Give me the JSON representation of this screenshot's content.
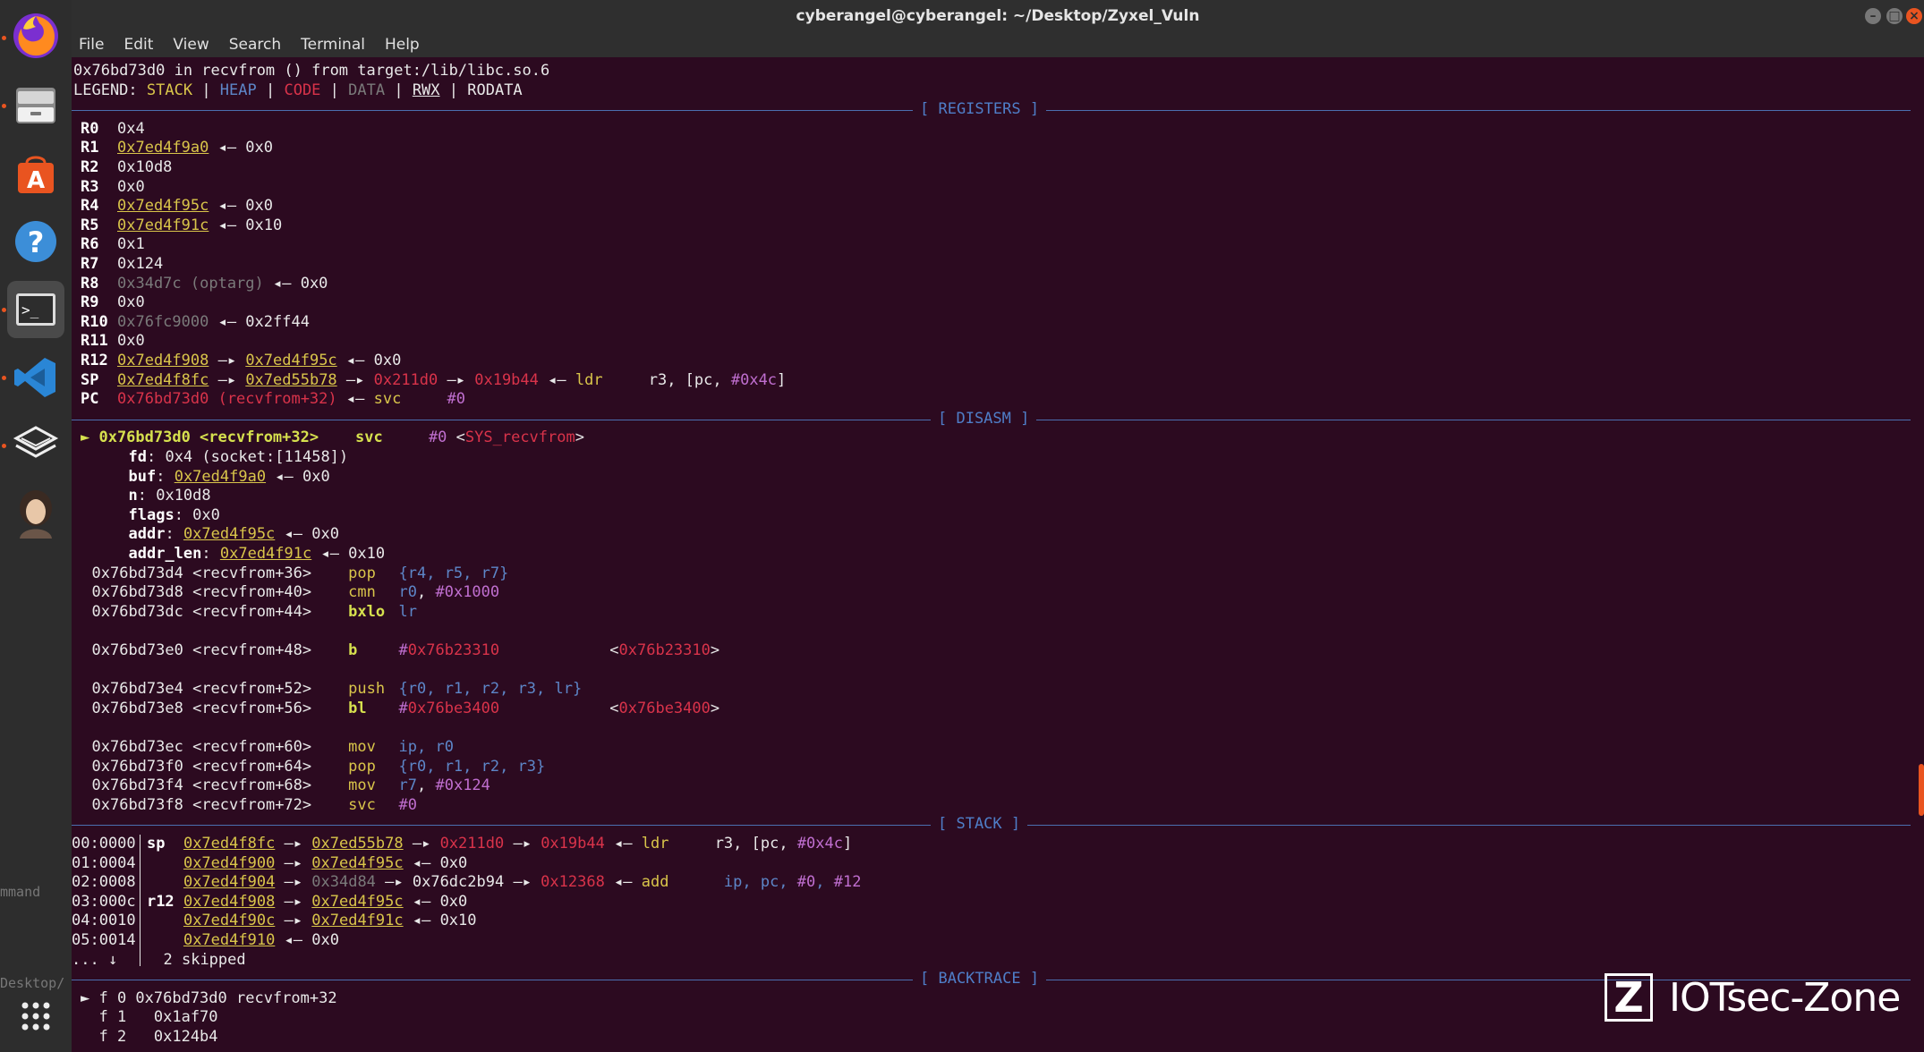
{
  "window": {
    "title": "cyberangel@cyberangel: ~/Desktop/Zyxel_Vuln",
    "menu": [
      "File",
      "Edit",
      "View",
      "Search",
      "Terminal",
      "Help"
    ]
  },
  "dock": {
    "items": [
      "firefox-icon",
      "files-icon",
      "app-store-icon",
      "help-icon",
      "terminal-icon",
      "vscode-icon",
      "layers-app-icon",
      "avatar-app-icon"
    ],
    "ghost_texts": [
      "mmand",
      "Desktop/"
    ]
  },
  "colors": {
    "background": "#2c0a20",
    "header": "#4f7ec8",
    "pointer": "#d9c54a",
    "code": "#d9334a",
    "accent": "#e95420"
  },
  "terminal": {
    "top_line": "0x76bd73d0 in recvfrom () from target:/lib/libc.so.6",
    "legend": {
      "label": "LEGEND: ",
      "stack": "STACK",
      "heap": "HEAP",
      "code": "CODE",
      "data": "DATA",
      "rwx": "RWX",
      "rodata": "RODATA",
      "sep": " | "
    },
    "sections": {
      "registers": "[ REGISTERS ]",
      "disasm": "[ DISASM ]",
      "stack": "[ STACK ]",
      "backtrace": "[ BACKTRACE ]"
    },
    "registers": [
      {
        "name": "R0",
        "parts": [
          [
            "w",
            "0x4"
          ]
        ]
      },
      {
        "name": "R1",
        "parts": [
          [
            "u",
            "0x7ed4f9a0"
          ],
          [
            "w",
            " ◂— 0x0"
          ]
        ]
      },
      {
        "name": "R2",
        "parts": [
          [
            "w",
            "0x10d8"
          ]
        ]
      },
      {
        "name": "R3",
        "parts": [
          [
            "w",
            "0x0"
          ]
        ]
      },
      {
        "name": "R4",
        "parts": [
          [
            "u",
            "0x7ed4f95c"
          ],
          [
            "w",
            " ◂— 0x0"
          ]
        ]
      },
      {
        "name": "R5",
        "parts": [
          [
            "u",
            "0x7ed4f91c"
          ],
          [
            "w",
            " ◂— 0x10"
          ]
        ]
      },
      {
        "name": "R6",
        "parts": [
          [
            "w",
            "0x1"
          ]
        ]
      },
      {
        "name": "R7",
        "parts": [
          [
            "w",
            "0x124"
          ]
        ]
      },
      {
        "name": "R8",
        "parts": [
          [
            "g",
            "0x34d7c (optarg)"
          ],
          [
            "w",
            " ◂— 0x0"
          ]
        ]
      },
      {
        "name": "R9",
        "parts": [
          [
            "w",
            "0x0"
          ]
        ]
      },
      {
        "name": "R10",
        "parts": [
          [
            "g",
            "0x76fc9000"
          ],
          [
            "w",
            " ◂— 0x2ff44"
          ]
        ]
      },
      {
        "name": "R11",
        "parts": [
          [
            "w",
            "0x0"
          ]
        ]
      },
      {
        "name": "R12",
        "parts": [
          [
            "u",
            "0x7ed4f908"
          ],
          [
            "w",
            " —▸ "
          ],
          [
            "u",
            "0x7ed4f95c"
          ],
          [
            "w",
            " ◂— 0x0"
          ]
        ]
      },
      {
        "name": "SP",
        "parts": [
          [
            "u",
            "0x7ed4f8fc"
          ],
          [
            "w",
            " —▸ "
          ],
          [
            "u",
            "0x7ed55b78"
          ],
          [
            "w",
            " —▸ "
          ],
          [
            "r",
            "0x211d0"
          ],
          [
            "w",
            " —▸ "
          ],
          [
            "r",
            "0x19b44"
          ],
          [
            "w",
            " ◂— "
          ],
          [
            "y",
            "ldr    "
          ],
          [
            "w",
            " r3, [pc, "
          ],
          [
            "m",
            "#0x4c"
          ],
          [
            "w",
            "]"
          ]
        ]
      },
      {
        "name": "PC",
        "parts": [
          [
            "r",
            "0x76bd73d0 (recvfrom+32)"
          ],
          [
            "w",
            " ◂— "
          ],
          [
            "y",
            "svc    "
          ],
          [
            "w",
            " "
          ],
          [
            "m",
            "#0"
          ]
        ]
      }
    ],
    "disasm": {
      "current": [
        [
          "gr",
          "► 0x76bd73d0 <recvfrom+32>    svc    "
        ],
        [
          "m",
          " #0"
        ],
        [
          "w",
          " <"
        ],
        [
          "r",
          "SYS_recvfrom"
        ],
        [
          "w",
          ">"
        ]
      ],
      "args": [
        [
          [
            "b",
            "fd"
          ],
          [
            "w",
            ": 0x4 (socket:[11458])"
          ]
        ],
        [
          [
            "b",
            "buf"
          ],
          [
            "w",
            ": "
          ],
          [
            "u",
            "0x7ed4f9a0"
          ],
          [
            "w",
            " ◂— 0x0"
          ]
        ],
        [
          [
            "b",
            "n"
          ],
          [
            "w",
            ": 0x10d8"
          ]
        ],
        [
          [
            "b",
            "flags"
          ],
          [
            "w",
            ": 0x0"
          ]
        ],
        [
          [
            "b",
            "addr"
          ],
          [
            "w",
            ": "
          ],
          [
            "u",
            "0x7ed4f95c"
          ],
          [
            "w",
            " ◂— 0x0"
          ]
        ],
        [
          [
            "b",
            "addr_len"
          ],
          [
            "w",
            ": "
          ],
          [
            "u",
            "0x7ed4f91c"
          ],
          [
            "w",
            " ◂— 0x10"
          ]
        ]
      ],
      "lines": [
        {
          "gap": 0,
          "addr": "0x76bd73d4 <recvfrom+36>",
          "mn": "pop",
          "mc": "y",
          "ops": [
            [
              "bl",
              "{r4, r5, r7}"
            ]
          ]
        },
        {
          "gap": 0,
          "addr": "0x76bd73d8 <recvfrom+40>",
          "mn": "cmn",
          "mc": "y",
          "ops": [
            [
              "bl",
              "r0"
            ],
            [
              "w",
              ", "
            ],
            [
              "m",
              "#0x1000"
            ]
          ]
        },
        {
          "gap": 0,
          "addr": "0x76bd73dc <recvfrom+44>",
          "mn": "bxlo",
          "mc": "gr",
          "ops": [
            [
              "bl",
              "lr"
            ]
          ]
        },
        {
          "gap": 1,
          "addr": "0x76bd73e0 <recvfrom+48>",
          "mn": "b",
          "mc": "gr",
          "ops": [
            [
              "m",
              "#"
            ],
            [
              "r",
              "0x76b23310"
            ]
          ],
          "target": "0x76b23310"
        },
        {
          "gap": 1,
          "addr": "0x76bd73e4 <recvfrom+52>",
          "mn": "push",
          "mc": "y",
          "ops": [
            [
              "bl",
              "{r0, r1, r2, r3, lr}"
            ]
          ]
        },
        {
          "gap": 0,
          "addr": "0x76bd73e8 <recvfrom+56>",
          "mn": "bl",
          "mc": "gr",
          "ops": [
            [
              "m",
              "#"
            ],
            [
              "r",
              "0x76be3400"
            ]
          ],
          "target": "0x76be3400"
        },
        {
          "gap": 1,
          "addr": "0x76bd73ec <recvfrom+60>",
          "mn": "mov",
          "mc": "y",
          "ops": [
            [
              "bl",
              "ip, r0"
            ]
          ]
        },
        {
          "gap": 0,
          "addr": "0x76bd73f0 <recvfrom+64>",
          "mn": "pop",
          "mc": "y",
          "ops": [
            [
              "bl",
              "{r0, r1, r2, r3}"
            ]
          ]
        },
        {
          "gap": 0,
          "addr": "0x76bd73f4 <recvfrom+68>",
          "mn": "mov",
          "mc": "y",
          "ops": [
            [
              "bl",
              "r7"
            ],
            [
              "w",
              ", "
            ],
            [
              "m",
              "#0x124"
            ]
          ]
        },
        {
          "gap": 0,
          "addr": "0x76bd73f8 <recvfrom+72>",
          "mn": "svc",
          "mc": "y",
          "ops": [
            [
              "m",
              "#0"
            ]
          ]
        }
      ]
    },
    "stack": [
      {
        "off": "00:0000",
        "reg": "sp",
        "parts": [
          [
            "u",
            "0x7ed4f8fc"
          ],
          [
            "w",
            " —▸ "
          ],
          [
            "u",
            "0x7ed55b78"
          ],
          [
            "w",
            " —▸ "
          ],
          [
            "r",
            "0x211d0"
          ],
          [
            "w",
            " —▸ "
          ],
          [
            "r",
            "0x19b44"
          ],
          [
            "w",
            " ◂— "
          ],
          [
            "y",
            "ldr    "
          ],
          [
            "w",
            " r3, [pc, "
          ],
          [
            "m",
            "#0x4c"
          ],
          [
            "w",
            "]"
          ]
        ]
      },
      {
        "off": "01:0004",
        "reg": "",
        "parts": [
          [
            "u",
            "0x7ed4f900"
          ],
          [
            "w",
            " —▸ "
          ],
          [
            "u",
            "0x7ed4f95c"
          ],
          [
            "w",
            " ◂— 0x0"
          ]
        ]
      },
      {
        "off": "02:0008",
        "reg": "",
        "parts": [
          [
            "u",
            "0x7ed4f904"
          ],
          [
            "w",
            " —▸ "
          ],
          [
            "g",
            "0x34d84"
          ],
          [
            "w",
            " —▸ 0x76dc2b94 —▸ "
          ],
          [
            "r",
            "0x12368"
          ],
          [
            "w",
            " ◂— "
          ],
          [
            "y",
            "add    "
          ],
          [
            "bl",
            "  ip, pc, "
          ],
          [
            "m",
            "#0"
          ],
          [
            "bl",
            ", "
          ],
          [
            "m",
            "#12"
          ]
        ]
      },
      {
        "off": "03:000c",
        "reg": "r12",
        "parts": [
          [
            "u",
            "0x7ed4f908"
          ],
          [
            "w",
            " —▸ "
          ],
          [
            "u",
            "0x7ed4f95c"
          ],
          [
            "w",
            " ◂— 0x0"
          ]
        ]
      },
      {
        "off": "04:0010",
        "reg": "",
        "parts": [
          [
            "u",
            "0x7ed4f90c"
          ],
          [
            "w",
            " —▸ "
          ],
          [
            "u",
            "0x7ed4f91c"
          ],
          [
            "w",
            " ◂— 0x10"
          ]
        ]
      },
      {
        "off": "05:0014",
        "reg": "",
        "parts": [
          [
            "u",
            "0x7ed4f910"
          ],
          [
            "w",
            " ◂— 0x0"
          ]
        ]
      }
    ],
    "stack_skip": {
      "left": "... ↓",
      "right": "2 skipped"
    },
    "backtrace": [
      "► f 0 0x76bd73d0 recvfrom+32",
      "  f 1   0x1af70",
      "  f 2   0x124b4"
    ]
  },
  "watermark": {
    "mark": "Z",
    "text": "IOTsec-Zone"
  }
}
